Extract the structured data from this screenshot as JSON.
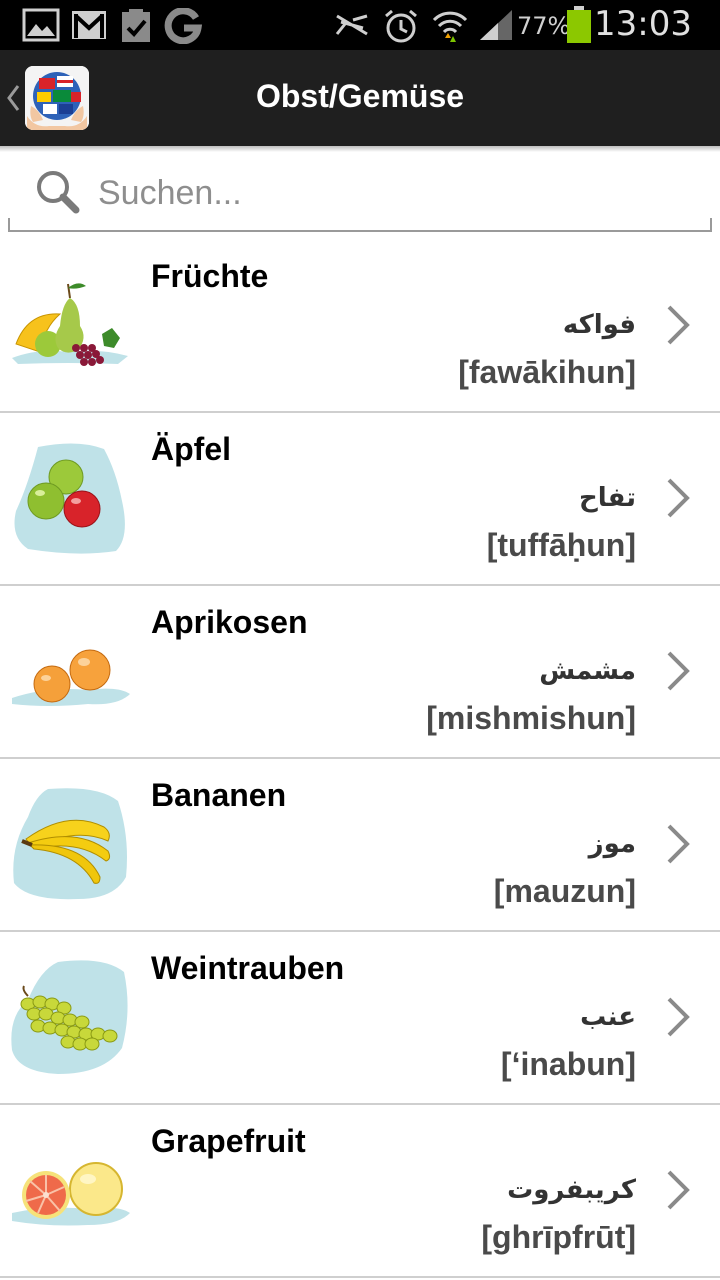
{
  "status_bar": {
    "battery_percent": "77%",
    "time": "13:03",
    "icons": [
      "gallery-icon",
      "gmail-icon",
      "clipboard-icon",
      "google-icon",
      "mute-icon",
      "alarm-icon",
      "wifi-icon",
      "signal-icon",
      "battery-icon"
    ]
  },
  "action_bar": {
    "title": "Obst/Gemüse",
    "back_icon": "chevron-left-icon",
    "app_icon": "globe-flags-icon"
  },
  "search": {
    "placeholder": "Suchen...",
    "value": ""
  },
  "items": [
    {
      "de": "Früchte",
      "ar": "فواكه",
      "tr": "[fawākihun]",
      "icon": "mixed-fruit-icon"
    },
    {
      "de": "Äpfel",
      "ar": "تفاح",
      "tr": "[tuffāḥun]",
      "icon": "apples-icon"
    },
    {
      "de": "Aprikosen",
      "ar": "مشمش",
      "tr": "[mishmishun]",
      "icon": "apricots-icon"
    },
    {
      "de": "Bananen",
      "ar": "موز",
      "tr": "[mauzun]",
      "icon": "bananas-icon"
    },
    {
      "de": "Weintrauben",
      "ar": "عنب",
      "tr": "[‘inabun]",
      "icon": "grapes-icon"
    },
    {
      "de": "Grapefruit",
      "ar": "كريبفروت",
      "tr": "[ghrīpfrūt]",
      "icon": "grapefruit-icon"
    }
  ],
  "colors": {
    "action_bar": "#1f1f1f",
    "status_bar": "#000000",
    "battery": "#8cc800",
    "thumb_bg": "#bfe2e8"
  }
}
